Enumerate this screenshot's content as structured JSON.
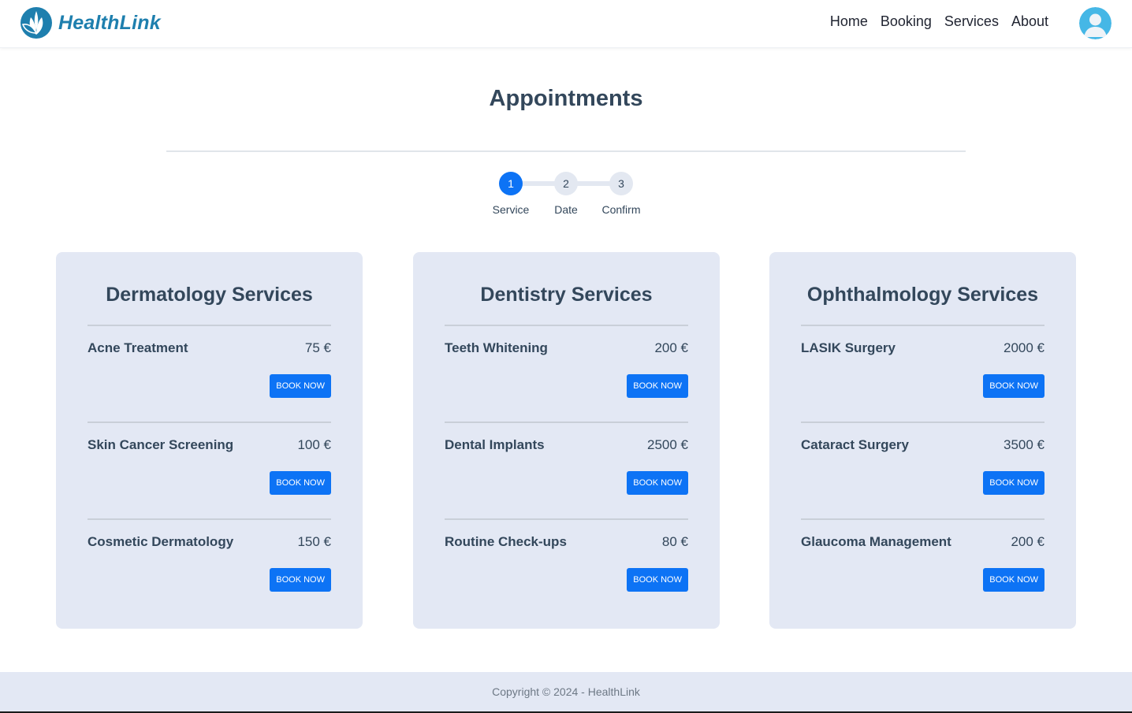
{
  "brand": {
    "name": "HealthLink",
    "color": "#1e7fae"
  },
  "nav": {
    "items": [
      "Home",
      "Booking",
      "Services",
      "About"
    ]
  },
  "page": {
    "title": "Appointments"
  },
  "stepper": {
    "steps": [
      {
        "number": "1",
        "label": "Service",
        "active": true
      },
      {
        "number": "2",
        "label": "Date",
        "active": false
      },
      {
        "number": "3",
        "label": "Confirm",
        "active": false
      }
    ]
  },
  "categories": [
    {
      "title": "Dermatology Services",
      "services": [
        {
          "name": "Acne Treatment",
          "price": "75 €",
          "button": "BOOK NOW"
        },
        {
          "name": "Skin Cancer Screening",
          "price": "100 €",
          "button": "BOOK NOW"
        },
        {
          "name": "Cosmetic Dermatology",
          "price": "150 €",
          "button": "BOOK NOW"
        }
      ]
    },
    {
      "title": "Dentistry Services",
      "services": [
        {
          "name": "Teeth Whitening",
          "price": "200 €",
          "button": "BOOK NOW"
        },
        {
          "name": "Dental Implants",
          "price": "2500 €",
          "button": "BOOK NOW"
        },
        {
          "name": "Routine Check-ups",
          "price": "80 €",
          "button": "BOOK NOW"
        }
      ]
    },
    {
      "title": "Ophthalmology Services",
      "services": [
        {
          "name": "LASIK Surgery",
          "price": "2000 €",
          "button": "BOOK NOW"
        },
        {
          "name": "Cataract Surgery",
          "price": "3500 €",
          "button": "BOOK NOW"
        },
        {
          "name": "Glaucoma Management",
          "price": "200 €",
          "button": "BOOK NOW"
        }
      ]
    }
  ],
  "footer": {
    "text": "Copyright © 2024 - HealthLink"
  },
  "colors": {
    "accent": "#0d73f5",
    "card_bg": "#e3e8f4",
    "text": "#33475b"
  },
  "icons": {
    "logo": "leaf-logo-icon",
    "avatar": "user-avatar-icon"
  }
}
